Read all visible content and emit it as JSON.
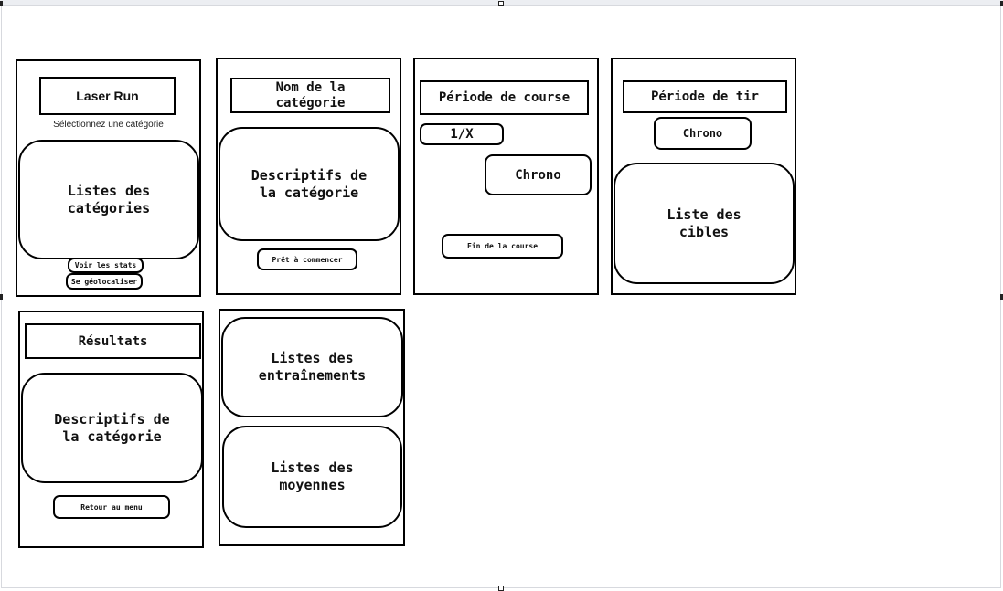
{
  "screen1": {
    "title": "Laser Run",
    "subtitle": "Sélectionnez une catégorie",
    "list": "Listes des catégories",
    "stats_button": "Voir les stats",
    "geo_button": "Se géolocaliser"
  },
  "screen2": {
    "title": "Nom de la catégorie",
    "description": "Descriptifs de la catégorie",
    "start_button": "Prêt à commencer"
  },
  "screen3": {
    "title": "Période de course",
    "lap_counter": "1/X",
    "chrono": "Chrono",
    "end_button": "Fin de la course"
  },
  "screen4": {
    "title": "Période de tir",
    "chrono": "Chrono",
    "targets": "Liste des cibles"
  },
  "screen5": {
    "title": "Résultats",
    "description": "Descriptifs de la catégorie",
    "menu_button": "Retour au menu"
  },
  "screen6": {
    "trainings": "Listes des entraînements",
    "averages": "Listes des moyennes"
  }
}
